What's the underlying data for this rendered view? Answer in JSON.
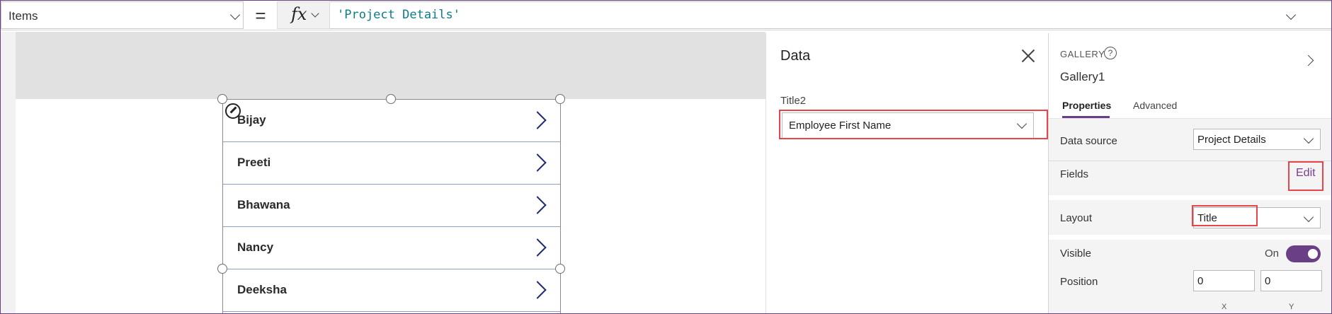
{
  "formula_bar": {
    "property": "Items",
    "equals": "=",
    "fx": "fx",
    "formula": "'Project Details'"
  },
  "gallery": {
    "items": [
      "Bijay",
      "Preeti",
      "Bhawana",
      "Nancy",
      "Deeksha"
    ]
  },
  "data_panel": {
    "title": "Data",
    "field_label": "Title2",
    "field_value": "Employee First Name"
  },
  "properties": {
    "control_type": "GALLERY",
    "help": "?",
    "control_name": "Gallery1",
    "tabs": [
      "Properties",
      "Advanced"
    ],
    "data_source_label": "Data source",
    "data_source_value": "Project Details",
    "fields_label": "Fields",
    "fields_edit": "Edit",
    "layout_label": "Layout",
    "layout_value": "Title",
    "visible_label": "Visible",
    "visible_value": "On",
    "position_label": "Position",
    "position_x": "0",
    "position_y": "0",
    "x_label": "X",
    "y_label": "Y"
  },
  "colors": {
    "accent": "#6b3f86",
    "highlight": "#e8454a",
    "formula_text": "#0e7c86"
  }
}
